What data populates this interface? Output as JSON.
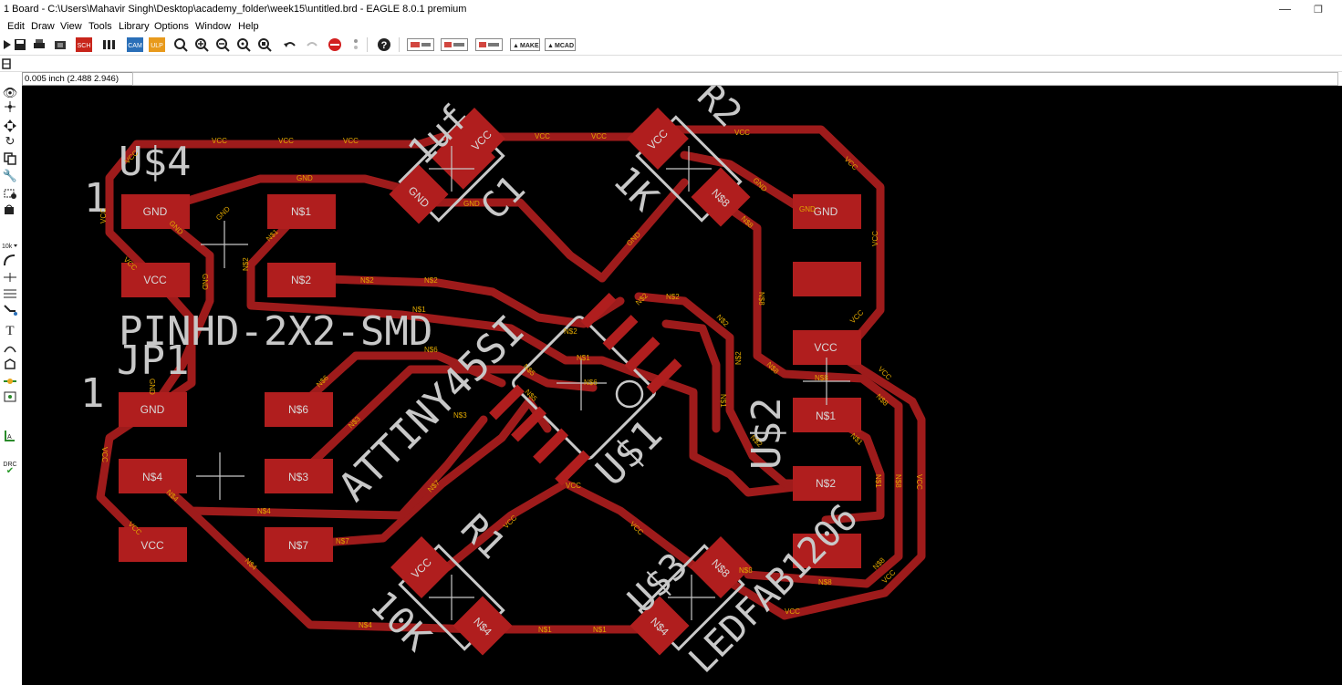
{
  "window": {
    "title": "1 Board - C:\\Users\\Mahavir Singh\\Desktop\\academy_folder\\week15\\untitled.brd - EAGLE 8.0.1 premium",
    "minimize_glyph": "—",
    "restore_glyph": "❐"
  },
  "menu": {
    "items": [
      "Edit",
      "Draw",
      "View",
      "Tools",
      "Library",
      "Options",
      "Window",
      "Help"
    ]
  },
  "toolbar": {
    "sch_label": "SCH",
    "cam_label": "CAM",
    "ulp_label": "ULP",
    "make_label": "MAKE",
    "mcad_label": "MCAD"
  },
  "status": {
    "coord_text": "0.005 inch (2.488 2.946)"
  },
  "sidebar": {
    "text_tool": "T",
    "drc_label": "DRC"
  },
  "board": {
    "colors": {
      "copper": "#9e1b1b",
      "pad": "#b01e1e",
      "silk": "#c8c8c8",
      "signal_label": "#e1a800",
      "bg": "#000000"
    },
    "labels": {
      "u4": "U$4",
      "jp1_pkg": "PINHD-2X2-SMD",
      "jp1": "JP1",
      "pin1_a": "1",
      "pin1_b": "1",
      "c1_value": "1uf",
      "c1": "C1",
      "r2": "R2",
      "r2_value": "1K",
      "attiny": "ATTINY45SI",
      "u1": "U$1",
      "u2": "U$2",
      "r1": "R1",
      "r1_value": "10K",
      "u3": "U$3",
      "led": "LEDFAB1206"
    },
    "pads": {
      "gnd_a": "GND",
      "n1_a": "N$1",
      "vcc_a": "VCC",
      "n2_a": "N$2",
      "gnd_b": "GND",
      "n6": "N$6",
      "n4_a": "N$4",
      "n3": "N$3",
      "vcc_b": "VCC",
      "n7": "N$7",
      "gnd_right": "GND",
      "vcc_right": "VCC",
      "n1_right": "N$1",
      "n2_right": "N$2",
      "c1_vcc": "VCC",
      "c1_gnd": "GND",
      "r2_vcc": "VCC",
      "r2_n8": "N$8",
      "r1_vcc": "VCC",
      "r1_n4": "N$4",
      "u3_n8": "N$8",
      "u3_n4": "N$4"
    },
    "signals": {
      "vcc": "VCC",
      "gnd": "GND",
      "n1": "N$1",
      "n2": "N$2",
      "n3": "N$3",
      "n4": "N$4",
      "n5": "N$5",
      "n6": "N$6",
      "n7": "N$7",
      "n8": "N$8"
    }
  }
}
